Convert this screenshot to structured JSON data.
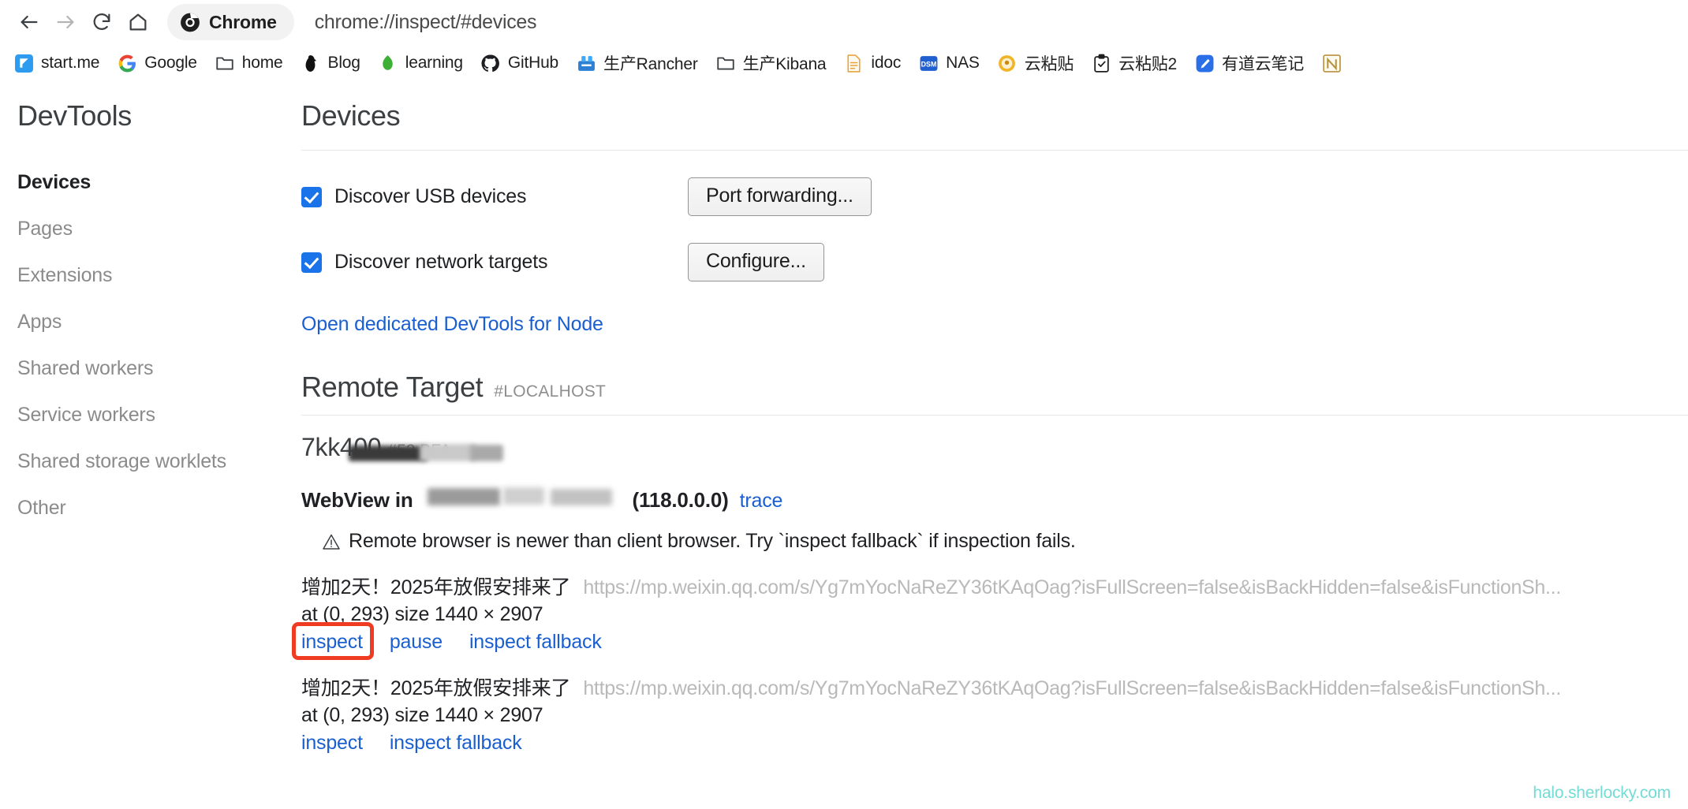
{
  "browser": {
    "nav": {
      "back_icon": "arrow-left-icon",
      "forward_icon": "arrow-right-icon",
      "reload_icon": "reload-icon",
      "home_icon": "home-icon"
    },
    "tab": {
      "title": "Chrome",
      "favicon": "chrome-logo-icon"
    },
    "omnibox": {
      "value": "chrome://inspect/#devices"
    },
    "bookmarks": [
      {
        "label": "start.me",
        "icon": "startme-icon"
      },
      {
        "label": "Google",
        "icon": "google-g-icon"
      },
      {
        "label": "home",
        "icon": "folder-icon"
      },
      {
        "label": "Blog",
        "icon": "blog-icon"
      },
      {
        "label": "learning",
        "icon": "leaf-icon"
      },
      {
        "label": "GitHub",
        "icon": "github-icon"
      },
      {
        "label": "生产Rancher",
        "icon": "rancher-icon"
      },
      {
        "label": "生产Kibana",
        "icon": "folder-icon"
      },
      {
        "label": "idoc",
        "icon": "document-icon"
      },
      {
        "label": "NAS",
        "icon": "dsm-icon"
      },
      {
        "label": "云粘贴",
        "icon": "paste-icon"
      },
      {
        "label": "云粘贴2",
        "icon": "clipboard-check-icon"
      },
      {
        "label": "有道云笔记",
        "icon": "youdao-note-icon"
      },
      {
        "label": "",
        "icon": "note-n-icon"
      }
    ]
  },
  "devtools": {
    "brand": "DevTools",
    "sidebar": [
      {
        "label": "Devices",
        "active": true
      },
      {
        "label": "Pages",
        "active": false
      },
      {
        "label": "Extensions",
        "active": false
      },
      {
        "label": "Apps",
        "active": false
      },
      {
        "label": "Shared workers",
        "active": false
      },
      {
        "label": "Service workers",
        "active": false
      },
      {
        "label": "Shared storage worklets",
        "active": false
      },
      {
        "label": "Other",
        "active": false
      }
    ],
    "page_title": "Devices",
    "discover_usb": {
      "label": "Discover USB devices",
      "checked": true,
      "button": "Port forwarding..."
    },
    "discover_network": {
      "label": "Discover network targets",
      "checked": true,
      "button": "Configure..."
    },
    "node_link": "Open dedicated DevTools for Node",
    "remote_target": {
      "title": "Remote Target",
      "host": "#LOCALHOST",
      "device_name": "7kk400",
      "device_serial": "#52    BFA",
      "browser_prefix": "WebView in",
      "browser_version": "(118.0.0.0)",
      "trace_link": "trace",
      "warning_icon": "warning-triangle-icon",
      "warning": "Remote browser is newer than client browser. Try `inspect fallback` if inspection fails.",
      "targets": [
        {
          "title": "增加2天！2025年放假安排来了",
          "url": "https://mp.weixin.qq.com/s/Yg7mYocNaReZY36tKAqOag?isFullScreen=false&isBackHidden=false&isFunctionSh...",
          "meta": "at (0, 293)  size 1440 × 2907",
          "actions": [
            "inspect",
            "pause",
            "inspect fallback"
          ],
          "highlighted_action": "inspect"
        },
        {
          "title": "增加2天！2025年放假安排来了",
          "url": "https://mp.weixin.qq.com/s/Yg7mYocNaReZY36tKAqOag?isFullScreen=false&isBackHidden=false&isFunctionSh...",
          "meta": "at (0, 293)  size 1440 × 2907",
          "actions": [
            "inspect",
            "inspect fallback"
          ],
          "highlighted_action": ""
        }
      ]
    }
  },
  "watermark": "halo.sherlocky.com",
  "colors": {
    "link": "#1a5fd0",
    "checkbox": "#1a73e8",
    "highlight": "#ef3b21",
    "watermark": "#72dcd4"
  }
}
